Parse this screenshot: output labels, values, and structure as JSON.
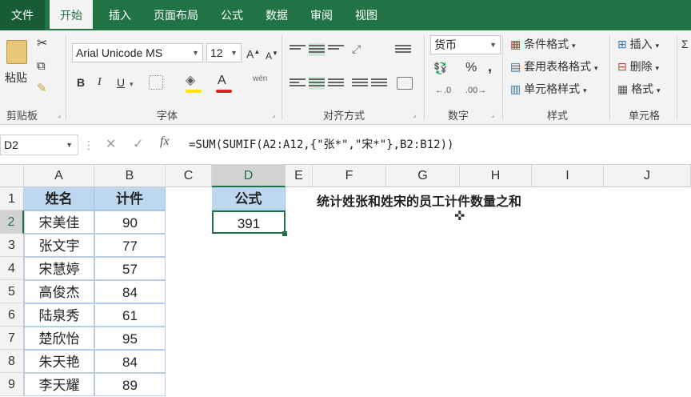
{
  "tabs": [
    "文件",
    "开始",
    "插入",
    "页面布局",
    "公式",
    "数据",
    "审阅",
    "视图"
  ],
  "ribbon": {
    "clipboard": {
      "paste": "粘贴",
      "label": "剪贴板"
    },
    "font": {
      "name": "Arial Unicode MS",
      "size": "12",
      "bold": "B",
      "italic": "I",
      "underline": "U",
      "label": "字体",
      "grow": "A",
      "shrink": "A",
      "font_color_glyph": "A",
      "phonetic": "wén"
    },
    "align": {
      "label": "对齐方式"
    },
    "number": {
      "format": "货币",
      "percent": "%",
      "comma": ",",
      "label": "数字"
    },
    "styles": {
      "conditional": "条件格式",
      "table": "套用表格格式",
      "cell": "单元格样式",
      "label": "样式"
    },
    "cells": {
      "insert": "插入",
      "delete": "删除",
      "format": "格式",
      "label": "单元格"
    }
  },
  "formula_bar": {
    "name_box": "D2",
    "formula": "=SUM(SUMIF(A2:A12,{\"张*\",\"宋*\"},B2:B12))"
  },
  "columns": [
    "A",
    "B",
    "C",
    "D",
    "E",
    "F",
    "G",
    "H",
    "I",
    "J"
  ],
  "rows": [
    "1",
    "2",
    "3",
    "4",
    "5",
    "6",
    "7",
    "8",
    "9"
  ],
  "table": {
    "headers": [
      "姓名",
      "计件"
    ],
    "data": [
      [
        "宋美佳",
        "90"
      ],
      [
        "张文宇",
        "77"
      ],
      [
        "宋慧婷",
        "57"
      ],
      [
        "高俊杰",
        "84"
      ],
      [
        "陆泉秀",
        "61"
      ],
      [
        "楚欣怡",
        "95"
      ],
      [
        "朱天艳",
        "84"
      ],
      [
        "李天耀",
        "89"
      ]
    ]
  },
  "formula_cell": {
    "header": "公式",
    "value": "391"
  },
  "note": "统计姓张和姓宋的员工计件数量之和",
  "colors": {
    "accent": "#217346",
    "header_fill": "#bdd7ee"
  }
}
